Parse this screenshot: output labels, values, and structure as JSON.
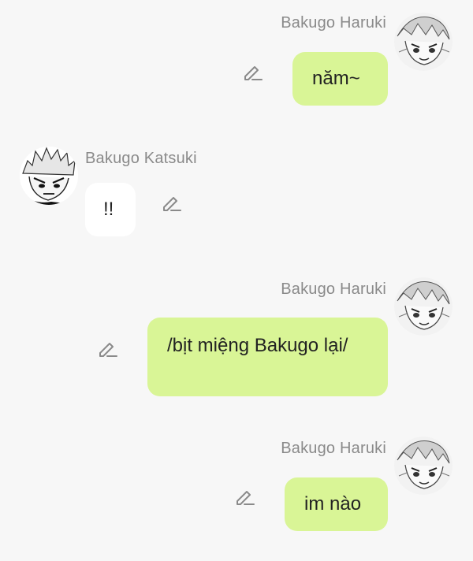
{
  "messages": [
    {
      "sender": "Bakugo Haruki",
      "text": "năm~",
      "side": "right",
      "avatar": "haruki-avatar",
      "edit_icon": "pencil-icon"
    },
    {
      "sender": "Bakugo Katsuki",
      "text": "!!",
      "side": "left",
      "avatar": "katsuki-avatar",
      "edit_icon": "pencil-icon"
    },
    {
      "sender": "Bakugo Haruki",
      "text": "/bịt miệng Bakugo lại/",
      "side": "right",
      "avatar": "haruki-avatar",
      "edit_icon": "pencil-icon"
    },
    {
      "sender": "Bakugo Haruki",
      "text": "im nào",
      "side": "right",
      "avatar": "haruki-avatar",
      "edit_icon": "pencil-icon"
    }
  ],
  "colors": {
    "background": "#f7f7f7",
    "my_bubble": "#d9f596",
    "other_bubble": "#ffffff",
    "name_text": "#8a8a8a",
    "icon": "#8a8a8a"
  }
}
